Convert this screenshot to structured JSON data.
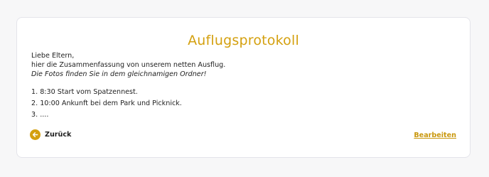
{
  "protocol": {
    "title": "Auflugsprotokoll",
    "greeting": "Liebe Eltern,",
    "intro": "hier die Zusammenfassung von unserem netten Ausflug.",
    "note": "Die Fotos finden Sie in dem gleichnamigen Ordner!",
    "steps": [
      "1. 8:30 Start vom Spatzennest.",
      "2. 10:00 Ankunft bei dem Park und Picknick.",
      "3. ...."
    ]
  },
  "actions": {
    "back_label": "Zurück",
    "back_icon": "arrow-left-icon",
    "edit_label": "Bearbeiten"
  },
  "colors": {
    "accent": "#d4a00f",
    "background": "#f7f7f8",
    "card": "#ffffff",
    "text": "#1f1f1f"
  }
}
